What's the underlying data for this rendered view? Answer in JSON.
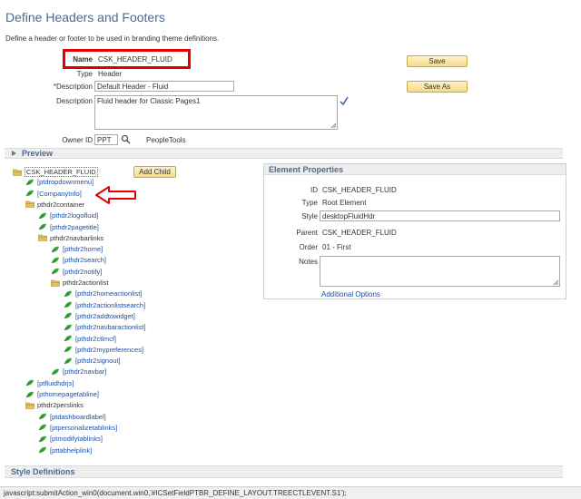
{
  "page": {
    "title": "Define Headers and Footers",
    "subtitle": "Define a header or footer to be used in branding theme definitions."
  },
  "form": {
    "name_label": "Name",
    "name_value": "CSK_HEADER_FLUID",
    "type_label": "Type",
    "type_value": "Header",
    "description_label": "*Description",
    "description_value": "Default Header - Fluid",
    "long_description_label": "Description",
    "long_description_value": "Fluid header for Classic Pages1",
    "owner_label": "Owner ID",
    "owner_value": "PPT",
    "owner_name": "PeopleTools",
    "save_label": "Save",
    "save_as_label": "Save As"
  },
  "preview": {
    "label": "Preview"
  },
  "tree": {
    "add_child_label": "Add Child",
    "items": [
      {
        "label": "CSK_HEADER_FLUID",
        "kind": "folder"
      },
      {
        "label": "[ptdropdownmenu]",
        "kind": "leaf"
      },
      {
        "label": "[CompanyInfo]",
        "kind": "leaf"
      },
      {
        "label": "pthdr2container",
        "kind": "folder"
      },
      {
        "label": "[pthdr2logofluid]",
        "kind": "leaf"
      },
      {
        "label": "[pthdr2pagetitle]",
        "kind": "leaf"
      },
      {
        "label": "pthdr2navbarlinks",
        "kind": "folder"
      },
      {
        "label": "[pthdr2home]",
        "kind": "leaf"
      },
      {
        "label": "[pthdr2search]",
        "kind": "leaf"
      },
      {
        "label": "[pthdr2notify]",
        "kind": "leaf"
      },
      {
        "label": "pthdr2actionlist",
        "kind": "folder"
      },
      {
        "label": "[pthdr2homeactionlist]",
        "kind": "leaf"
      },
      {
        "label": "[pthdr2actionlistsearch]",
        "kind": "leaf"
      },
      {
        "label": "[pthdr2addtowidget]",
        "kind": "leaf"
      },
      {
        "label": "[pthdr2navbaractionlist]",
        "kind": "leaf"
      },
      {
        "label": "[pthdr2ctlmcf]",
        "kind": "leaf"
      },
      {
        "label": "[pthdr2mypreferences]",
        "kind": "leaf"
      },
      {
        "label": "[pthdr2signout]",
        "kind": "leaf"
      },
      {
        "label": "[pthdr2navbar]",
        "kind": "leaf"
      },
      {
        "label": "[ptfluidhdrjs]",
        "kind": "leaf"
      },
      {
        "label": "[pthomepagetabline]",
        "kind": "leaf"
      },
      {
        "label": "pthdr2perslinks",
        "kind": "folder"
      },
      {
        "label": "[ptdashboardlabel]",
        "kind": "leaf"
      },
      {
        "label": "[ptpersonalizetablinks]",
        "kind": "leaf"
      },
      {
        "label": "[ptmodifytablinks]",
        "kind": "leaf"
      },
      {
        "label": "[pttabhelplink]",
        "kind": "leaf"
      }
    ]
  },
  "element_properties": {
    "title": "Element Properties",
    "id_label": "ID",
    "id_value": "CSK_HEADER_FLUID",
    "type_label": "Type",
    "type_value": "Root Element",
    "style_label": "Style",
    "style_value": "desktopFluidHdr",
    "parent_label": "Parent",
    "parent_value": "CSK_HEADER_FLUID",
    "order_label": "Order",
    "order_value": "01 - First",
    "notes_label": "Notes",
    "additional_options_label": "Additional Options"
  },
  "style_definitions": {
    "title": "Style Definitions"
  },
  "status_bar": {
    "text": "javascript:submitAction_win0(document.win0,'#ICSetFieldPTBR_DEFINE_LAYOUT.TREECTLEVENT.S1');"
  },
  "colors": {
    "title": "#4a6a94",
    "link": "#1e4fa5",
    "highlight": "#e00000",
    "button_bg": "#f4d98a",
    "leaf_icon": "#3aa83a",
    "folder_icon": "#d9b24a"
  }
}
